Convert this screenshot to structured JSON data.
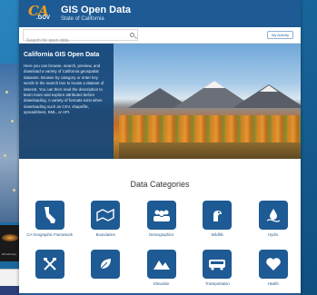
{
  "header": {
    "logo_text": "CA",
    "logo_suffix": ".GOV",
    "title": "GIS Open Data",
    "subtitle": "State of California"
  },
  "search": {
    "placeholder": "Search for open data",
    "top_button": "My Activity"
  },
  "hero": {
    "title": "California GIS Open Data",
    "text": "Here you can browse, search, preview, and download a variety of California geospatial datasets. Browse by category or enter key words in the search box to locate a dataset of interest. You can then read the description to learn more and explore attributes before downloading. A variety of formats exist when downloading such as CSV, shapefile, spreadsheet, KML, or API."
  },
  "categories": {
    "heading": "Data Categories",
    "items": [
      {
        "label": "CA Geographic Framework",
        "icon": "california-icon"
      },
      {
        "label": "Boundaries",
        "icon": "boundaries-icon"
      },
      {
        "label": "Demographics",
        "icon": "people-icon"
      },
      {
        "label": "Wildlife",
        "icon": "wildlife-icon"
      },
      {
        "label": "Hydro",
        "icon": "water-drop-icon"
      },
      {
        "label": "",
        "icon": "tools-icon"
      },
      {
        "label": "",
        "icon": "leaf-icon"
      },
      {
        "label": "Elevation",
        "icon": "mountain-icon"
      },
      {
        "label": "Transportation",
        "icon": "bus-icon"
      },
      {
        "label": "Health",
        "icon": "health-icon"
      }
    ]
  },
  "background": {
    "map_caption": "28 February"
  },
  "colors": {
    "brand_blue": "#1e5a94",
    "accent_gold": "#f0a020"
  }
}
